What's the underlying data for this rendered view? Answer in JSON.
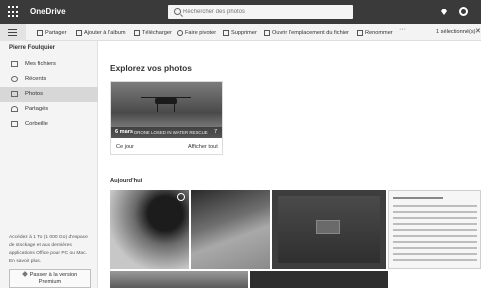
{
  "topbar": {
    "app_title": "OneDrive",
    "search_placeholder": "Rechercher des photos"
  },
  "commands": {
    "share": "Partager",
    "add_to_album": "Ajouter à l'album",
    "download": "Télécharger",
    "rotate": "Faire pivoter",
    "delete": "Supprimer",
    "open_location": "Ouvrir l'emplacement du fichier",
    "rename": "Renommer",
    "more": "···",
    "selected_count": "1 sélectionné(s)",
    "clear": "✕"
  },
  "sidebar": {
    "user": "Pierre Foulquier",
    "items": [
      {
        "label": "Mes fichiers",
        "icon": "folder-icon"
      },
      {
        "label": "Récents",
        "icon": "clock-icon"
      },
      {
        "label": "Photos",
        "icon": "photo-icon"
      },
      {
        "label": "Partagés",
        "icon": "people-icon"
      },
      {
        "label": "Corbeille",
        "icon": "trash-icon"
      }
    ],
    "storage_text": "Accédez à 1 To (1 000 Go) d'espace de stockage et aux dernières applications Office pour PC ou Mac. En savoir plus.",
    "premium_line1": "Passer à la version",
    "premium_line2": "Premium"
  },
  "main": {
    "explore_title": "Explorez vos photos",
    "memory": {
      "date": "6 mars",
      "caption": "DRONE LOSED IN WATER RESCUE",
      "count": "7",
      "when": "Ce jour",
      "show_all": "Afficher tout"
    },
    "today_label": "Aujourd'hui"
  }
}
